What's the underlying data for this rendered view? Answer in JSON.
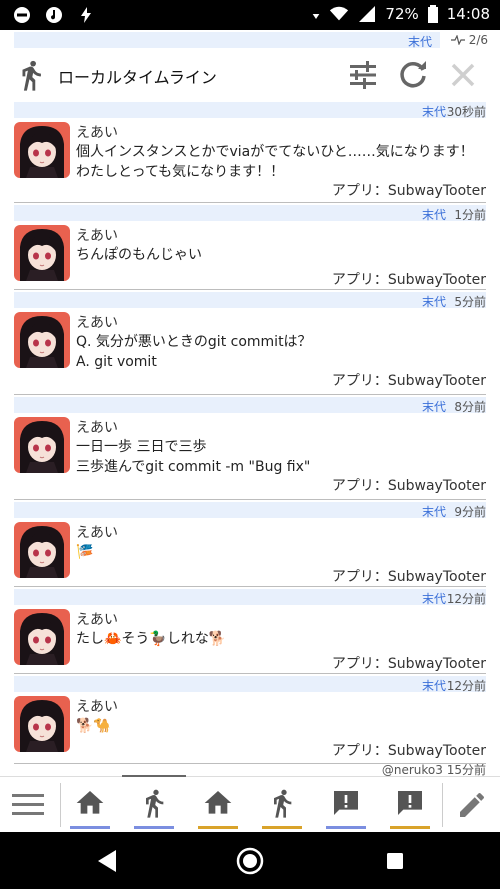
{
  "status_bar": {
    "battery": "72%",
    "time": "14:08"
  },
  "column": {
    "account": "末代",
    "page_indicator": "2/6",
    "title": "ローカルタイムライン"
  },
  "posts": [
    {
      "account": "末代",
      "time": "30秒前",
      "name": "えあい",
      "content": "個人インスタンスとかでviaがでてないひと……気になります！わたしとっても気になります！！",
      "app": "アプリ：SubwayTooter"
    },
    {
      "account": "末代",
      "time": "1分前",
      "name": "えあい",
      "content": "ちんぽのもんじゃい",
      "app": "アプリ：SubwayTooter"
    },
    {
      "account": "末代",
      "time": "5分前",
      "name": "えあい",
      "content": "Q. 気分が悪いときのgit commitは？\nA. git vomit",
      "app": "アプリ：SubwayTooter"
    },
    {
      "account": "末代",
      "time": "8分前",
      "name": "えあい",
      "content": "一日一歩 三日で三歩\n三歩進んでgit commit -m \"Bug fix\"",
      "app": "アプリ：SubwayTooter"
    },
    {
      "account": "末代",
      "time": "9分前",
      "name": "えあい",
      "content": "🎏",
      "app": "アプリ：SubwayTooter"
    },
    {
      "account": "末代",
      "time": "12分前",
      "name": "えあい",
      "content": "たし🦀そう🦆しれな🐕",
      "app": "アプリ：SubwayTooter"
    },
    {
      "account": "末代",
      "time": "12分前",
      "name": "えあい",
      "content": "🐕🐪",
      "app": "アプリ：SubwayTooter"
    }
  ],
  "peek_row": "@neruko3 15分前",
  "tabs": [
    {
      "icon": "home-icon",
      "indicator": "#7b8ee0"
    },
    {
      "icon": "walking-person-icon",
      "indicator": "#7b8ee0",
      "selected": true
    },
    {
      "icon": "home-icon",
      "indicator": "#d9a32a"
    },
    {
      "icon": "walking-person-icon",
      "indicator": "#d9a32a"
    },
    {
      "icon": "notification-icon",
      "indicator": "#7b8ee0"
    },
    {
      "icon": "notification-icon",
      "indicator": "#d9a32a"
    }
  ],
  "colors": {
    "accent_blue": "#3a6fd8",
    "meta_strip": "#e8f0fc",
    "icon_gray": "#555555"
  }
}
